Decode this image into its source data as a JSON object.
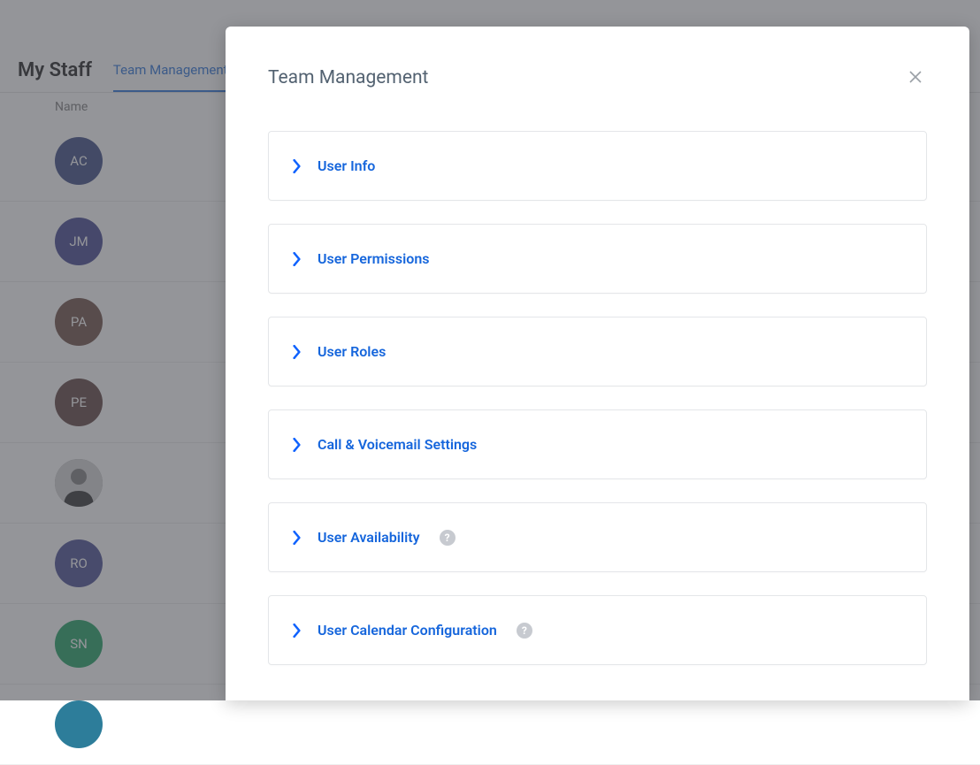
{
  "background": {
    "page_title": "My Staff",
    "active_tab": "Team Management",
    "column_label": "Name",
    "rows": [
      {
        "initials": "AC",
        "color": "#4c5a8f"
      },
      {
        "initials": "JM",
        "color": "#52559a"
      },
      {
        "initials": "PA",
        "color": "#7a5d55"
      },
      {
        "initials": "PE",
        "color": "#6d5350"
      },
      {
        "initials": "",
        "color": "photo"
      },
      {
        "initials": "RO",
        "color": "#585c9c"
      },
      {
        "initials": "SN",
        "color": "#31a86f"
      },
      {
        "initials": "",
        "color": "#2d7d9a"
      }
    ]
  },
  "modal": {
    "title": "Team Management",
    "sections": [
      {
        "label": "User Info",
        "help": false
      },
      {
        "label": "User Permissions",
        "help": false
      },
      {
        "label": "User Roles",
        "help": false
      },
      {
        "label": "Call & Voicemail Settings",
        "help": false
      },
      {
        "label": "User Availability",
        "help": true
      },
      {
        "label": "User Calendar Configuration",
        "help": true
      }
    ]
  }
}
